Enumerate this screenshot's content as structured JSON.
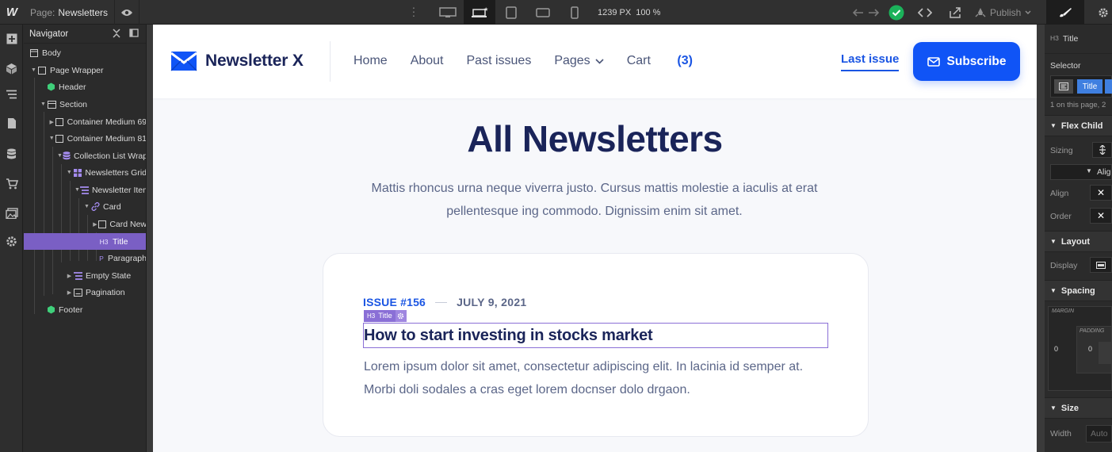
{
  "topbar": {
    "logo": "W",
    "page_label": "Page:",
    "page_name": "Newsletters",
    "width": "1239 PX",
    "zoom": "100 %",
    "publish": "Publish"
  },
  "navigator": {
    "title": "Navigator",
    "items": [
      {
        "label": "Body"
      },
      {
        "label": "Page Wrapper"
      },
      {
        "label": "Header"
      },
      {
        "label": "Section"
      },
      {
        "label": "Container Medium 69"
      },
      {
        "label": "Container Medium 81"
      },
      {
        "label": "Collection List Wrap"
      },
      {
        "label": "Newsletters Grid"
      },
      {
        "label": "Newsletter Item"
      },
      {
        "label": "Card"
      },
      {
        "label": "Card New"
      },
      {
        "label": "Title",
        "prefix": "H3"
      },
      {
        "label": "Paragraph",
        "prefix": "P"
      },
      {
        "label": "Empty State"
      },
      {
        "label": "Pagination"
      },
      {
        "label": "Footer"
      }
    ]
  },
  "site": {
    "logo_text": "Newsletter X",
    "menu": {
      "home": "Home",
      "about": "About",
      "past": "Past issues",
      "pages": "Pages",
      "cart": "Cart",
      "cart_count": "(3)"
    },
    "last_issue": "Last issue",
    "subscribe": "Subscribe",
    "colors": {
      "brand": "#1054f6",
      "heading": "#1a2459",
      "text": "#5b6688"
    }
  },
  "hero": {
    "title": "All Newsletters",
    "subtitle_line1": "Mattis rhoncus urna neque viverra justo. Cursus mattis molestie a iaculis at erat",
    "subtitle_line2": "pellentesque ing commodo. Dignissim enim sit amet."
  },
  "card": {
    "issue": "ISSUE #156",
    "date": "JULY 9, 2021",
    "tag_prefix": "H3",
    "tag_label": "Title",
    "title": "How to start investing in stocks market",
    "text_line1": "Lorem ipsum dolor sit amet, consectetur adipiscing elit. In lacinia id semper at.",
    "text_line2": "Morbi doli sodales a cras eget lorem docnser dolo drgaon."
  },
  "panel": {
    "element_prefix": "H3",
    "element_label": "Title",
    "selector_label": "Selector",
    "selector_chip": "Title",
    "on_page": "1 on this page, 2",
    "flex_child": "Flex Child",
    "sizing": "Sizing",
    "align_item": "Alig",
    "align": "Align",
    "order": "Order",
    "layout": "Layout",
    "display": "Display",
    "spacing": "Spacing",
    "margin": "MARGIN",
    "padding": "PADDING",
    "margin_val": "0",
    "padding_val": "0",
    "size": "Size",
    "width": "Width",
    "width_val": "Auto"
  }
}
